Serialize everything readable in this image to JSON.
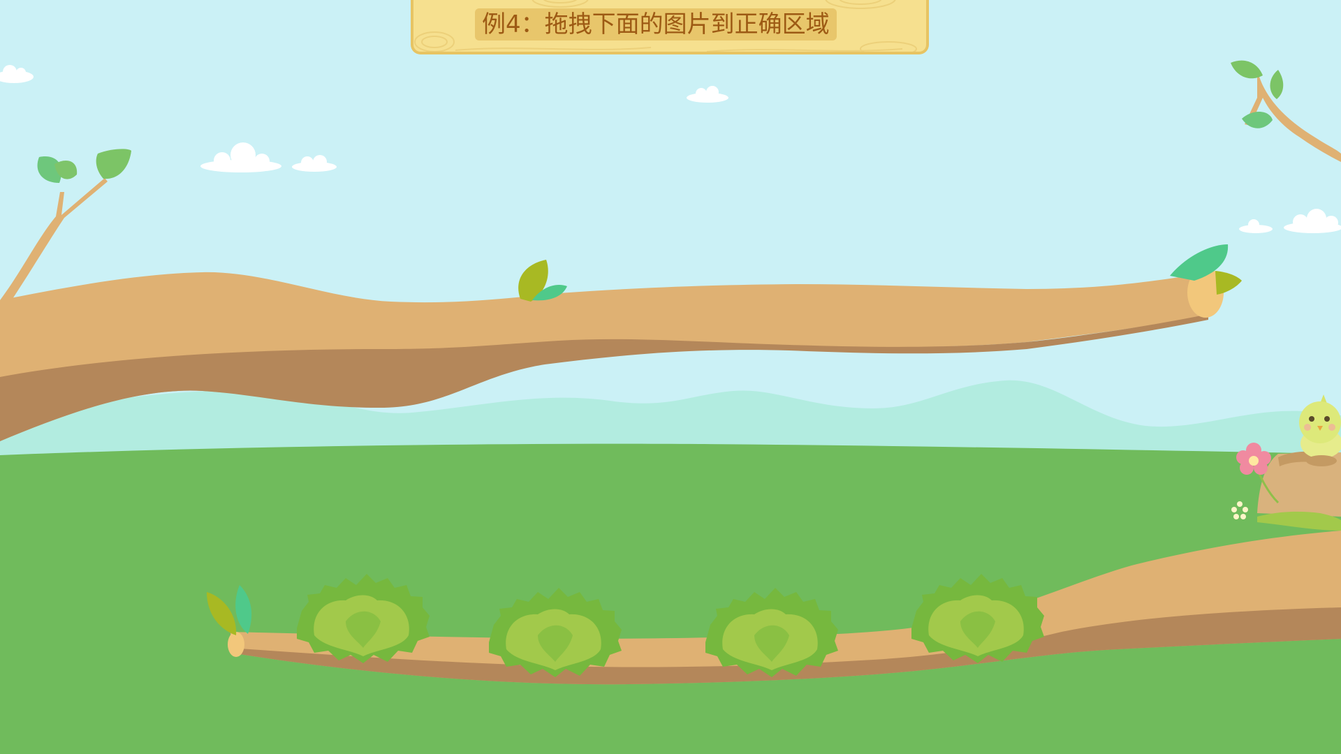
{
  "title": "例4：拖拽下面的图片到正确区域",
  "colors": {
    "sky": "#cbf1f6",
    "grass": "#70bb5c",
    "hills": "#b2ece0",
    "branch_light": "#dfb173",
    "branch_dark": "#b4875a",
    "branch_end": "#f2c77b",
    "leaf_green": "#6ec77c",
    "leaf_olive": "#a8b923",
    "bush_outer": "#76b83e",
    "bush_inner": "#a2c94b",
    "sign_bg": "#f6e08f",
    "sign_border": "#e7c463",
    "title_text": "#9d5a14"
  },
  "scene": {
    "bushes": [
      {
        "name": "bush-1",
        "icon": "bush-icon"
      },
      {
        "name": "bush-2",
        "icon": "bush-icon"
      },
      {
        "name": "bush-3",
        "icon": "bush-icon"
      },
      {
        "name": "bush-4",
        "icon": "bush-icon"
      }
    ],
    "character": "yellow-chick-icon",
    "decorations": [
      "cloud-icon",
      "flower-icon",
      "tree-stump-icon",
      "leaf-icon"
    ]
  }
}
